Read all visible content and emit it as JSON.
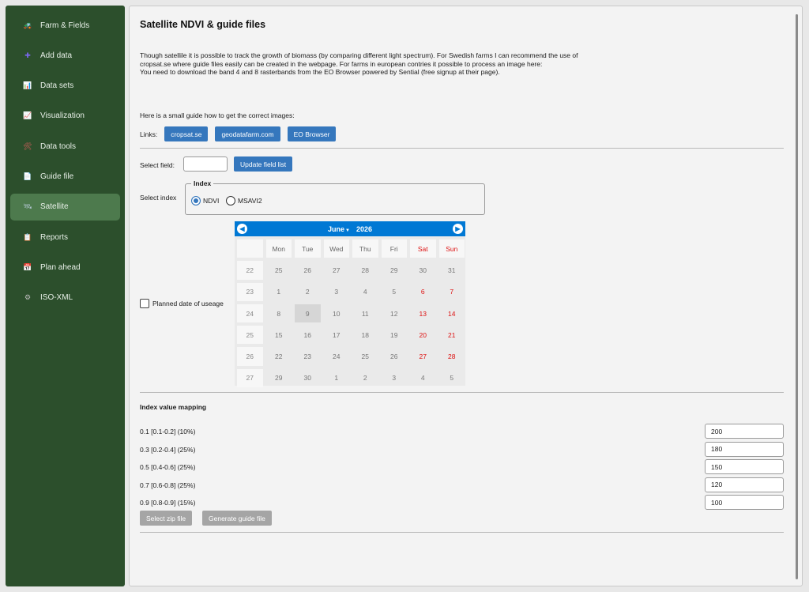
{
  "sidebar": {
    "items": [
      {
        "label": "Farm & Fields",
        "icon": "🚜",
        "icon_color": "#2ecc71"
      },
      {
        "label": "Add data",
        "icon": "✚",
        "icon_color": "#7b68ee"
      },
      {
        "label": "Data sets",
        "icon": "📊",
        "icon_color": "#4a90d9"
      },
      {
        "label": "Visualization",
        "icon": "📈",
        "icon_color": "#aab"
      },
      {
        "label": "Data tools",
        "icon": "🛠",
        "icon_color": "#e06060"
      },
      {
        "label": "Guide file",
        "icon": "📄",
        "icon_color": "#ddd"
      },
      {
        "label": "Satellite",
        "icon": "🛰",
        "icon_color": "#bcd",
        "active": true
      },
      {
        "label": "Reports",
        "icon": "📋",
        "icon_color": "#e0b070"
      },
      {
        "label": "Plan ahead",
        "icon": "📅",
        "icon_color": "#6aa0e0"
      },
      {
        "label": "ISO-XML",
        "icon": "⚙",
        "icon_color": "#bbb"
      }
    ]
  },
  "main": {
    "title": "Satellite NDVI & guide files",
    "intro_1": "Though satellile it is possible to track the growth of biomass (by comparing different light spectrum). For Swedish farms I can recommend the use of cropsat.se where guide files easily can be created in the webpage. For farms in european contries it possible to process an image here:",
    "intro_2": "You need to download the band 4 and 8 rasterbands from the EO Browser powered by Sential (free signup at their page).",
    "guide": "Here is a small guide how to get the correct images:",
    "links_label": "Links:",
    "links": [
      "cropsat.se",
      "geodatafarm.com",
      "EO Browser"
    ],
    "select_field_label": "Select field:",
    "select_field_value": "",
    "update_button": "Update field list",
    "select_index_label": "Select index",
    "index_legend": "Index",
    "index_options": [
      "NDVI",
      "MSAVI2"
    ],
    "index_selected": "NDVI",
    "planned_date_label": "Planned date of useage",
    "calendar": {
      "month": "June",
      "year": "2026",
      "day_headers": [
        "Mon",
        "Tue",
        "Wed",
        "Thu",
        "Fri",
        "Sat",
        "Sun"
      ],
      "selected_day": "9",
      "weeks": [
        {
          "wk": "22",
          "days": [
            "25",
            "26",
            "27",
            "28",
            "29",
            "30",
            "31"
          ]
        },
        {
          "wk": "23",
          "days": [
            "1",
            "2",
            "3",
            "4",
            "5",
            "6",
            "7"
          ]
        },
        {
          "wk": "24",
          "days": [
            "8",
            "9",
            "10",
            "11",
            "12",
            "13",
            "14"
          ]
        },
        {
          "wk": "25",
          "days": [
            "15",
            "16",
            "17",
            "18",
            "19",
            "20",
            "21"
          ]
        },
        {
          "wk": "26",
          "days": [
            "22",
            "23",
            "24",
            "25",
            "26",
            "27",
            "28"
          ]
        },
        {
          "wk": "27",
          "days": [
            "29",
            "30",
            "1",
            "2",
            "3",
            "4",
            "5"
          ]
        }
      ]
    },
    "mapping_title": "Index value mapping",
    "mapping": [
      {
        "label": "0.1 [0.1-0.2] (10%)",
        "value": "200"
      },
      {
        "label": "0.3 [0.2-0.4] (25%)",
        "value": "180"
      },
      {
        "label": "0.5 [0.4-0.6] (25%)",
        "value": "150"
      },
      {
        "label": "0.7 [0.6-0.8] (25%)",
        "value": "120"
      },
      {
        "label": "0.9 [0.8-0.9] (15%)",
        "value": "100"
      }
    ],
    "select_zip_button": "Select zip file",
    "generate_button": "Generate guide file"
  }
}
